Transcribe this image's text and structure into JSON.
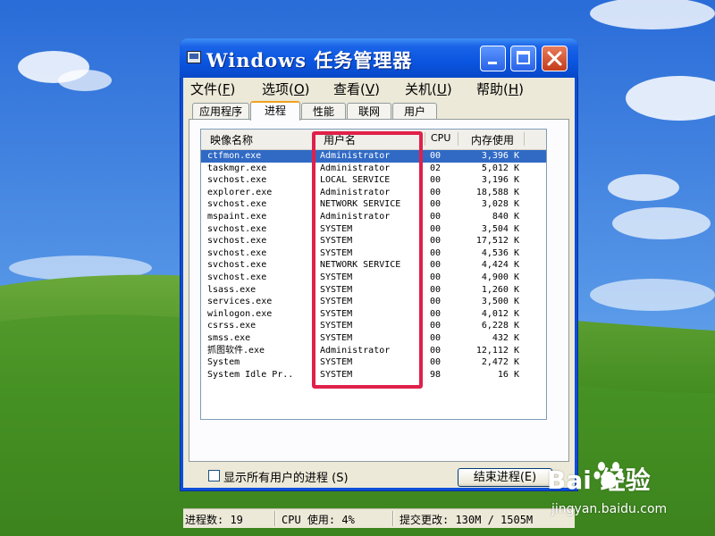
{
  "window": {
    "title": "Windows 任务管理器"
  },
  "menubar": {
    "items": [
      {
        "label": "文件(",
        "key": "F",
        "tail": ")"
      },
      {
        "label": "选项(",
        "key": "O",
        "tail": ")"
      },
      {
        "label": "查看(",
        "key": "V",
        "tail": ")"
      },
      {
        "label": "关机(",
        "key": "U",
        "tail": ")"
      },
      {
        "label": "帮助(",
        "key": "H",
        "tail": ")"
      }
    ]
  },
  "tabs": [
    {
      "label": "应用程序",
      "active": false
    },
    {
      "label": "进程",
      "active": true
    },
    {
      "label": "性能",
      "active": false
    },
    {
      "label": "联网",
      "active": false
    },
    {
      "label": "用户",
      "active": false
    }
  ],
  "columns": [
    "映像名称",
    "用户名",
    "CPU",
    "内存使用"
  ],
  "processes": [
    {
      "name": "ctfmon.exe",
      "user": "Administrator",
      "cpu": "00",
      "mem": "3,396 K",
      "selected": true
    },
    {
      "name": "taskmgr.exe",
      "user": "Administrator",
      "cpu": "02",
      "mem": "5,012 K"
    },
    {
      "name": "svchost.exe",
      "user": "LOCAL SERVICE",
      "cpu": "00",
      "mem": "3,196 K"
    },
    {
      "name": "explorer.exe",
      "user": "Administrator",
      "cpu": "00",
      "mem": "18,588 K"
    },
    {
      "name": "svchost.exe",
      "user": "NETWORK SERVICE",
      "cpu": "00",
      "mem": "3,028 K"
    },
    {
      "name": "mspaint.exe",
      "user": "Administrator",
      "cpu": "00",
      "mem": "840 K"
    },
    {
      "name": "svchost.exe",
      "user": "SYSTEM",
      "cpu": "00",
      "mem": "3,504 K"
    },
    {
      "name": "svchost.exe",
      "user": "SYSTEM",
      "cpu": "00",
      "mem": "17,512 K"
    },
    {
      "name": "svchost.exe",
      "user": "SYSTEM",
      "cpu": "00",
      "mem": "4,536 K"
    },
    {
      "name": "svchost.exe",
      "user": "NETWORK SERVICE",
      "cpu": "00",
      "mem": "4,424 K"
    },
    {
      "name": "svchost.exe",
      "user": "SYSTEM",
      "cpu": "00",
      "mem": "4,900 K"
    },
    {
      "name": "lsass.exe",
      "user": "SYSTEM",
      "cpu": "00",
      "mem": "1,260 K"
    },
    {
      "name": "services.exe",
      "user": "SYSTEM",
      "cpu": "00",
      "mem": "3,500 K"
    },
    {
      "name": "winlogon.exe",
      "user": "SYSTEM",
      "cpu": "00",
      "mem": "4,012 K"
    },
    {
      "name": "csrss.exe",
      "user": "SYSTEM",
      "cpu": "00",
      "mem": "6,228 K"
    },
    {
      "name": "smss.exe",
      "user": "SYSTEM",
      "cpu": "00",
      "mem": "432 K"
    },
    {
      "name": "抓图软件.exe",
      "user": "Administrator",
      "cpu": "00",
      "mem": "12,112 K"
    },
    {
      "name": "System",
      "user": "SYSTEM",
      "cpu": "00",
      "mem": "2,472 K"
    },
    {
      "name": "System Idle Pr..",
      "user": "SYSTEM",
      "cpu": "98",
      "mem": "16 K"
    }
  ],
  "footer": {
    "show_all_users_label": "显示所有用户的进程 (S)",
    "end_process_label": "结束进程(E)"
  },
  "status": {
    "processes": "进程数: 19",
    "cpu": "CPU 使用: 4%",
    "commit": "提交更改: 130M / 1505M"
  },
  "watermark": {
    "brand": "Bai  经验",
    "sub": "jingyan.baidu.com"
  },
  "colors": {
    "highlight_box": "#e0204a",
    "selection": "#316ac5",
    "titlebar": "#0a55e0"
  }
}
